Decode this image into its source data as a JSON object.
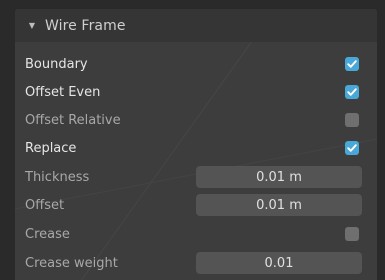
{
  "panel": {
    "title": "Wire Frame",
    "expanded": true
  },
  "rows": {
    "boundary": {
      "label": "Boundary",
      "checked": true
    },
    "offset_even": {
      "label": "Offset Even",
      "checked": true
    },
    "offset_relative": {
      "label": "Offset Relative",
      "checked": false
    },
    "replace": {
      "label": "Replace",
      "checked": true
    },
    "thickness": {
      "label": "Thickness",
      "value": "0.01 m"
    },
    "offset": {
      "label": "Offset",
      "value": "0.01 m"
    },
    "crease": {
      "label": "Crease",
      "checked": false
    },
    "crease_weight": {
      "label": "Crease weight",
      "value": "0.01"
    }
  },
  "colors": {
    "checkbox_on": "#4aa8d9",
    "checkbox_off": "#6f6f6f",
    "field_bg": "#545454",
    "panel_bg": "#3d3d3d"
  },
  "icons": {
    "collapse": "triangle-down-icon",
    "check": "checkmark-icon"
  }
}
